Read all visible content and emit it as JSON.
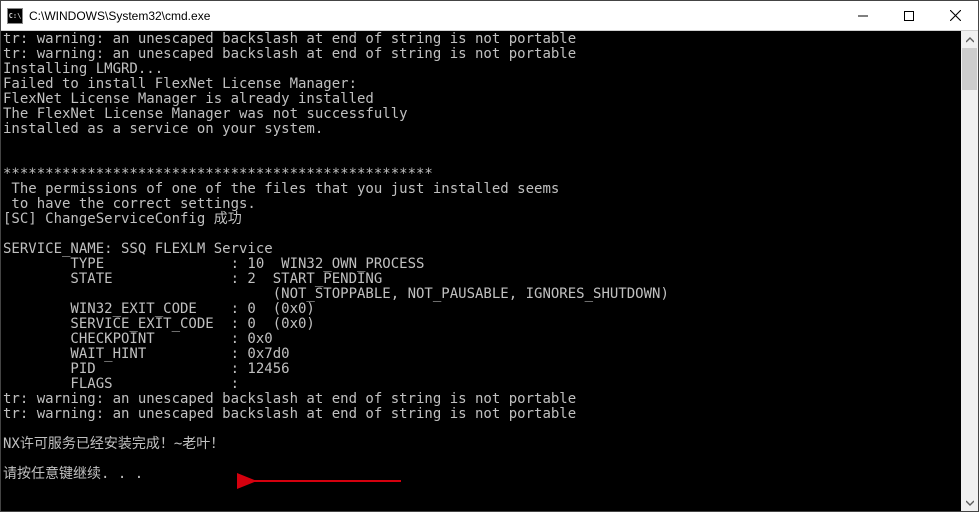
{
  "window": {
    "icon_label": "C:\\",
    "title": "C:\\WINDOWS\\System32\\cmd.exe"
  },
  "console": {
    "lines": [
      "tr: warning: an unescaped backslash at end of string is not portable",
      "tr: warning: an unescaped backslash at end of string is not portable",
      "Installing LMGRD...",
      "Failed to install FlexNet License Manager:",
      "FlexNet License Manager is already installed",
      "The FlexNet License Manager was not successfully",
      "installed as a service on your system.",
      "",
      "",
      "***************************************************",
      " The permissions of one of the files that you just installed seems",
      " to have the correct settings.",
      "[SC] ChangeServiceConfig 成功",
      "",
      "SERVICE_NAME: SSQ FLEXLM Service",
      "        TYPE               : 10  WIN32_OWN_PROCESS",
      "        STATE              : 2  START_PENDING",
      "                                (NOT_STOPPABLE, NOT_PAUSABLE, IGNORES_SHUTDOWN)",
      "        WIN32_EXIT_CODE    : 0  (0x0)",
      "        SERVICE_EXIT_CODE  : 0  (0x0)",
      "        CHECKPOINT         : 0x0",
      "        WAIT_HINT          : 0x7d0",
      "        PID                : 12456",
      "        FLAGS              :",
      "tr: warning: an unescaped backslash at end of string is not portable",
      "tr: warning: an unescaped backslash at end of string is not portable",
      "",
      "NX许可服务已经安装完成！~老叶！",
      "",
      "请按任意键继续. . ."
    ]
  },
  "annotation": {
    "arrow_color": "#d4000e"
  }
}
